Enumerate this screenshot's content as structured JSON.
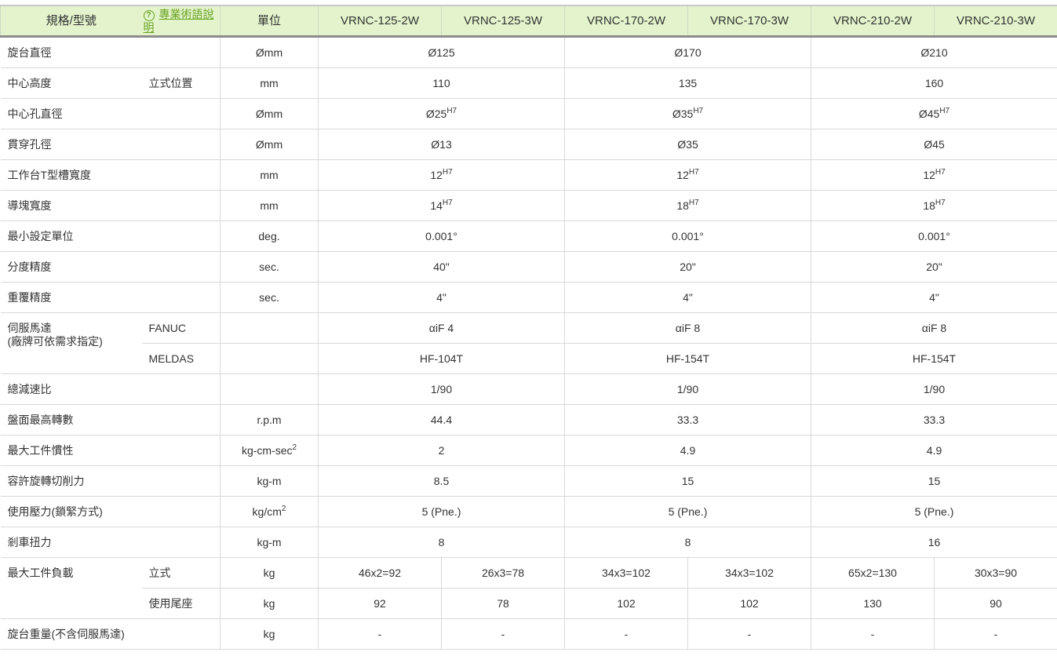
{
  "header": {
    "spec_label": "規格/型號",
    "help_link": "專業術語說明",
    "help_icon": "question-circle-icon",
    "unit_label": "單位",
    "models": [
      "VRNC-125-2W",
      "VRNC-125-3W",
      "VRNC-170-2W",
      "VRNC-170-3W",
      "VRNC-210-2W",
      "VRNC-210-3W"
    ]
  },
  "colors": {
    "header_bg": "#e3f4cc",
    "link": "#6aa323",
    "border": "#d9d9d9"
  },
  "rows": [
    {
      "label": "旋台直徑",
      "sub": "",
      "unit": "Ømm",
      "values": [
        "Ø125",
        "Ø170",
        "Ø210"
      ]
    },
    {
      "label": "中心高度",
      "sub": "立式位置",
      "unit": "mm",
      "values": [
        "110",
        "135",
        "160"
      ]
    },
    {
      "label": "中心孔直徑",
      "sub": "",
      "unit": "Ømm",
      "values": [
        {
          "base": "Ø25",
          "sup": "H7"
        },
        {
          "base": "Ø35",
          "sup": "H7"
        },
        {
          "base": "Ø45",
          "sup": "H7"
        }
      ]
    },
    {
      "label": "貫穿孔徑",
      "sub": "",
      "unit": "Ømm",
      "values": [
        "Ø13",
        "Ø35",
        "Ø45"
      ]
    },
    {
      "label": "工作台T型槽寬度",
      "sub": "",
      "unit": "mm",
      "values": [
        {
          "base": "12",
          "sup": "H7"
        },
        {
          "base": "12",
          "sup": "H7"
        },
        {
          "base": "12",
          "sup": "H7"
        }
      ]
    },
    {
      "label": "導塊寬度",
      "sub": "",
      "unit": "mm",
      "values": [
        {
          "base": "14",
          "sup": "H7"
        },
        {
          "base": "18",
          "sup": "H7"
        },
        {
          "base": "18",
          "sup": "H7"
        }
      ]
    },
    {
      "label": "最小設定單位",
      "sub": "",
      "unit": "deg.",
      "values": [
        "0.001°",
        "0.001°",
        "0.001°"
      ]
    },
    {
      "label": "分度精度",
      "sub": "",
      "unit": "sec.",
      "values": [
        "40\"",
        "20\"",
        "20\""
      ]
    },
    {
      "label": "重覆精度",
      "sub": "",
      "unit": "sec.",
      "values": [
        "4\"",
        "4\"",
        "4\""
      ]
    },
    {
      "label": "伺服馬達",
      "label2": "(廠牌可依需求指定)",
      "span": 2,
      "sub": "FANUC",
      "unit": "",
      "values": [
        "αiF 4",
        "αiF 8",
        "αiF 8"
      ]
    },
    {
      "sub": "MELDAS",
      "unit": "",
      "values": [
        "HF-104T",
        "HF-154T",
        "HF-154T"
      ]
    },
    {
      "label": "總減速比",
      "sub": "",
      "unit": "",
      "values": [
        "1/90",
        "1/90",
        "1/90"
      ]
    },
    {
      "label": "盤面最高轉數",
      "sub": "",
      "unit": "r.p.m",
      "values": [
        "44.4",
        "33.3",
        "33.3"
      ]
    },
    {
      "label": "最大工件慣性",
      "sub": "",
      "unit": {
        "base": "kg-cm-sec",
        "sup": "2"
      },
      "values": [
        "2",
        "4.9",
        "4.9"
      ]
    },
    {
      "label": "容許旋轉切削力",
      "sub": "",
      "unit": "kg-m",
      "values": [
        "8.5",
        "15",
        "15"
      ]
    },
    {
      "label": "使用壓力(鎖緊方式)",
      "sub": "",
      "unit": {
        "base": "kg/cm",
        "sup": "2"
      },
      "values": [
        "5 (Pne.)",
        "5 (Pne.)",
        "5 (Pne.)"
      ]
    },
    {
      "label": "剎車扭力",
      "sub": "",
      "unit": "kg-m",
      "values": [
        "8",
        "8",
        "16"
      ]
    },
    {
      "label": "最大工件負載",
      "span": 2,
      "sub": "立式",
      "unit": "kg",
      "values": [
        "46x2=92",
        "26x3=78",
        "34x3=102",
        "34x3=102",
        "65x2=130",
        "30x3=90"
      ]
    },
    {
      "sub": "使用尾座",
      "unit": "kg",
      "values": [
        "92",
        "78",
        "102",
        "102",
        "130",
        "90"
      ]
    },
    {
      "label": "旋台重量(不含伺服馬達)",
      "sub": "",
      "unit": "kg",
      "values": [
        "-",
        "-",
        "-",
        "-",
        "-",
        "-"
      ]
    }
  ]
}
